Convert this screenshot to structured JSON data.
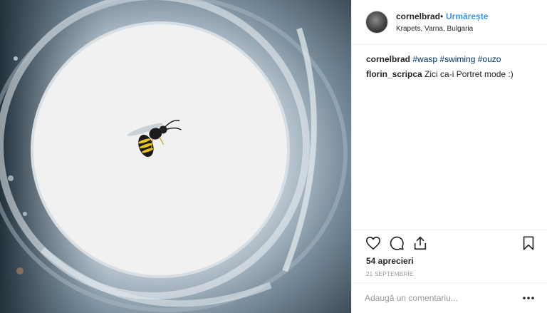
{
  "post": {
    "image_alt": "wasp in glass",
    "header": {
      "username": "cornelbrad",
      "separator": "•",
      "follow_label": "Urmărește",
      "location": "Krapets, Varna, Bulgaria"
    },
    "caption": {
      "username": "cornelbrad",
      "tags": [
        "#wasp",
        "#swiming",
        "#ouzo"
      ]
    },
    "comment": {
      "username": "florin_scripca",
      "text": "Zici ca-i Portret mode :)"
    },
    "likes_text": "54 aprecieri",
    "date": "21 SEPTEMBRIE",
    "add_comment_placeholder": "Adaugă un comentariu...",
    "icons": [
      "heart-icon",
      "comment-icon",
      "share-icon",
      "bookmark-icon",
      "more-options-icon"
    ],
    "colors": {
      "link": "#3897f0",
      "hashtag": "#003569",
      "text": "#262626",
      "muted": "#999999"
    }
  }
}
